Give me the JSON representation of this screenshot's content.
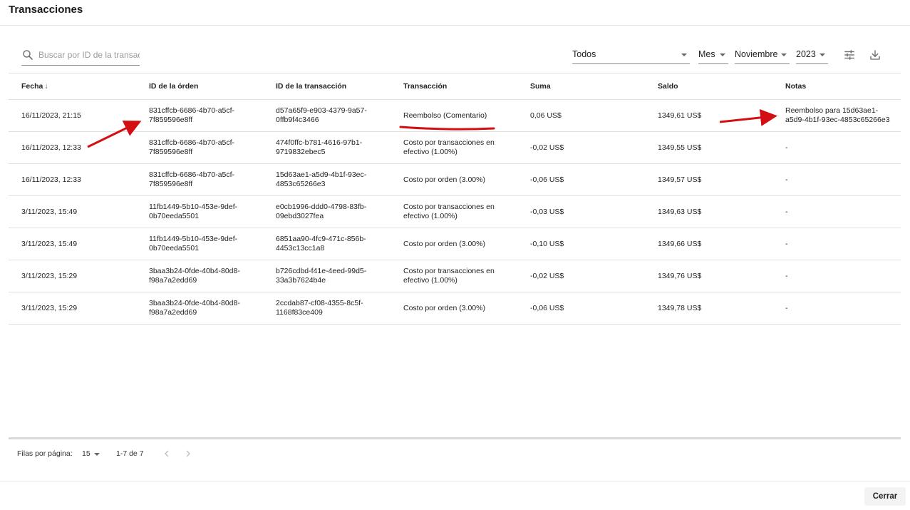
{
  "header": {
    "title": "Transacciones"
  },
  "filters": {
    "search_placeholder": "Buscar por ID de la transacción",
    "type_value": "Todos",
    "period_value": "Mes",
    "month_value": "Noviembre",
    "year_value": "2023"
  },
  "table": {
    "columns": [
      "Fecha",
      "ID de la órden",
      "ID de la transacción",
      "Transacción",
      "Suma",
      "Saldo",
      "Notas"
    ],
    "rows": [
      {
        "fecha": "16/11/2023, 21:15",
        "orden_1": "831cffcb-6686-4b70-a5cf-",
        "orden_2": "7f859596e8ff",
        "trans_1": "d57a65f9-e903-4379-9a57-",
        "trans_2": "0ffb9f4c3466",
        "tipo_1": "Reembolso (Comentario)",
        "tipo_2": "",
        "suma": "0,06 US$",
        "saldo": "1349,61 US$",
        "notas_1": "Reembolso para 15d63ae1-",
        "notas_2": "a5d9-4b1f-93ec-4853c65266e3"
      },
      {
        "fecha": "16/11/2023, 12:33",
        "orden_1": "831cffcb-6686-4b70-a5cf-",
        "orden_2": "7f859596e8ff",
        "trans_1": "474f0ffc-b781-4616-97b1-",
        "trans_2": "9719832ebec5",
        "tipo_1": "Costo por transacciones en",
        "tipo_2": "efectivo (1.00%)",
        "suma": "-0,02 US$",
        "saldo": "1349,55 US$",
        "notas_1": "-",
        "notas_2": ""
      },
      {
        "fecha": "16/11/2023, 12:33",
        "orden_1": "831cffcb-6686-4b70-a5cf-",
        "orden_2": "7f859596e8ff",
        "trans_1": "15d63ae1-a5d9-4b1f-93ec-",
        "trans_2": "4853c65266e3",
        "tipo_1": "Costo por orden (3.00%)",
        "tipo_2": "",
        "suma": "-0,06 US$",
        "saldo": "1349,57 US$",
        "notas_1": "-",
        "notas_2": ""
      },
      {
        "fecha": "3/11/2023, 15:49",
        "orden_1": "11fb1449-5b10-453e-9def-",
        "orden_2": "0b70eeda5501",
        "trans_1": "e0cb1996-ddd0-4798-83fb-",
        "trans_2": "09ebd3027fea",
        "tipo_1": "Costo por transacciones en",
        "tipo_2": "efectivo (1.00%)",
        "suma": "-0,03 US$",
        "saldo": "1349,63 US$",
        "notas_1": "-",
        "notas_2": ""
      },
      {
        "fecha": "3/11/2023, 15:49",
        "orden_1": "11fb1449-5b10-453e-9def-",
        "orden_2": "0b70eeda5501",
        "trans_1": "6851aa90-4fc9-471c-856b-",
        "trans_2": "4453c13cc1a8",
        "tipo_1": "Costo por orden (3.00%)",
        "tipo_2": "",
        "suma": "-0,10 US$",
        "saldo": "1349,66 US$",
        "notas_1": "-",
        "notas_2": ""
      },
      {
        "fecha": "3/11/2023, 15:29",
        "orden_1": "3baa3b24-0fde-40b4-80d8-",
        "orden_2": "f98a7a2edd69",
        "trans_1": "b726cdbd-f41e-4eed-99d5-",
        "trans_2": "33a3b7624b4e",
        "tipo_1": "Costo por transacciones en",
        "tipo_2": "efectivo (1.00%)",
        "suma": "-0,02 US$",
        "saldo": "1349,76 US$",
        "notas_1": "-",
        "notas_2": ""
      },
      {
        "fecha": "3/11/2023, 15:29",
        "orden_1": "3baa3b24-0fde-40b4-80d8-",
        "orden_2": "f98a7a2edd69",
        "trans_1": "2ccdab87-cf08-4355-8c5f-",
        "trans_2": "1168f83ce409",
        "tipo_1": "Costo por orden (3.00%)",
        "tipo_2": "",
        "suma": "-0,06 US$",
        "saldo": "1349,78 US$",
        "notas_1": "-",
        "notas_2": ""
      }
    ]
  },
  "pagination": {
    "rows_per_page_label": "Filas por página:",
    "rows_per_page_value": "15",
    "range": "1-7 de 7"
  },
  "footer": {
    "close_label": "Cerrar"
  },
  "icons": {
    "search": "search-icon",
    "filter": "tune-icon",
    "download": "download-icon",
    "prev": "chevron-left-icon",
    "next": "chevron-right-icon",
    "sort": "arrow-down-icon"
  },
  "colors": {
    "annotation": "#d40f14"
  }
}
